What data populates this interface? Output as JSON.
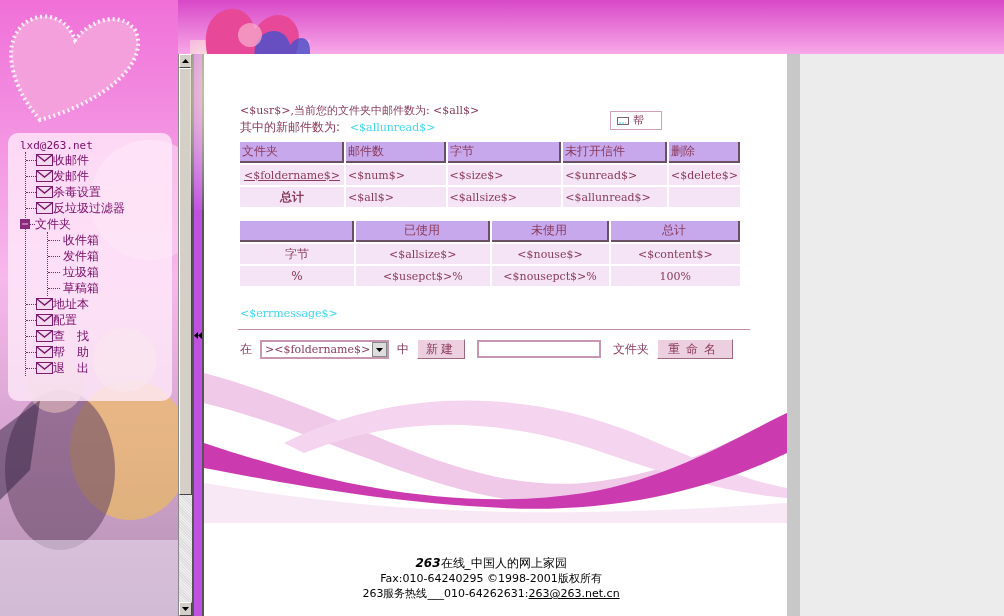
{
  "sidebar": {
    "account": "lxd@263.net",
    "items": [
      {
        "label": "收邮件",
        "kind": "mail"
      },
      {
        "label": "发邮件",
        "kind": "mail"
      },
      {
        "label": "杀毒设置",
        "kind": "mail"
      },
      {
        "label": "反垃圾过滤器",
        "kind": "mail"
      },
      {
        "label": "文件夹",
        "kind": "folder",
        "expanded": true,
        "children": [
          {
            "label": "收件箱"
          },
          {
            "label": "发件箱"
          },
          {
            "label": "垃圾箱"
          },
          {
            "label": "草稿箱"
          }
        ]
      },
      {
        "label": "地址本",
        "kind": "mail"
      },
      {
        "label": "配置",
        "kind": "mail"
      },
      {
        "label": "查　找",
        "kind": "mail"
      },
      {
        "label": "帮　助",
        "kind": "mail"
      },
      {
        "label": "退　出",
        "kind": "mail"
      }
    ]
  },
  "summary": {
    "mail_count": "<$usr$>,当前您的文件夹中邮件数为: <$all$>",
    "unread_label": "其中的新邮件数为:",
    "unread_value": "<$allunread$>"
  },
  "help_button": {
    "label": "帮"
  },
  "folder_table": {
    "columns": [
      "文件夹",
      "邮件数",
      "字节",
      "未打开信件",
      "删除"
    ],
    "rows": [
      {
        "kind": "folder",
        "cells": [
          "<$foldername$>",
          "<$num$>",
          "<$size$>",
          "<$unread$>",
          "<$delete$>"
        ]
      },
      {
        "kind": "total",
        "cells": [
          "总计",
          "<$all$>",
          "<$allsize$>",
          "<$allunread$>"
        ]
      }
    ]
  },
  "usage_table": {
    "columns": [
      "",
      "已使用",
      "未使用",
      "总计"
    ],
    "rows": [
      [
        "字节",
        "<$allsize$>",
        "<$nouse$>",
        "<$content$>"
      ],
      [
        "%",
        "<$usepct$>%",
        "<$nousepct$>%",
        "100%"
      ]
    ]
  },
  "error_message": "<$errmessage$>",
  "folder_form": {
    "prefix": "在",
    "select_value": "><$foldername$>",
    "middle": "中",
    "new_button": "新建",
    "suffix": "文件夹",
    "rename_button": "重命名"
  },
  "footer": {
    "title": "**263**在线_中国人的网上家园",
    "copyright": "Fax:010-64240295 ©1998-2001版权所有",
    "hotline": "263服务热线___010-64262631:",
    "email": "263@263.net.cn"
  }
}
